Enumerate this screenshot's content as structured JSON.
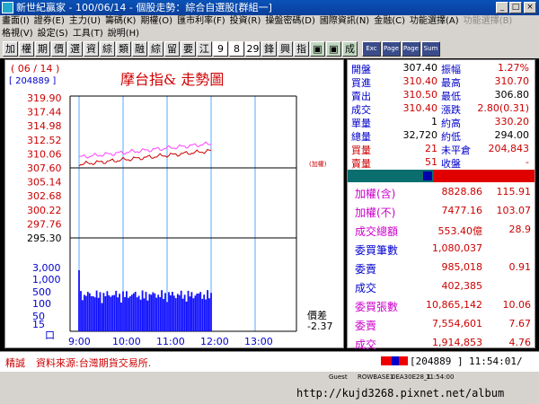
{
  "window": {
    "title": "新世紀贏家 - 100/06/14 - 個股走勢：綜合自選股[群組一]"
  },
  "menu_row1": [
    {
      "label": "畫面(I)"
    },
    {
      "label": "證券(E)"
    },
    {
      "label": "主力(U)"
    },
    {
      "label": "籌碼(K)"
    },
    {
      "label": "期權(O)"
    },
    {
      "label": "匯市利率(F)"
    },
    {
      "label": "投資(R)"
    },
    {
      "label": "操盤密碼(D)"
    },
    {
      "label": "國際資訊(N)"
    },
    {
      "label": "金融(C)"
    },
    {
      "label": "功能選擇(A)"
    },
    {
      "label": "功能選擇(B)",
      "disabled": true
    }
  ],
  "menu_row2": [
    {
      "label": "格視(V)"
    },
    {
      "label": "設定(S)"
    },
    {
      "label": "工具(T)"
    },
    {
      "label": "說明(H)"
    }
  ],
  "toolbar": {
    "buttons": [
      "加",
      "權",
      "期",
      "價",
      "選",
      "資",
      "綜",
      "類",
      "融",
      "綜",
      "留",
      "要",
      "江",
      "9",
      "8",
      "29",
      "鋒",
      "興",
      "指",
      "▣",
      "▣",
      "成"
    ],
    "icon_buttons": [
      "Exc",
      "Page",
      "Page",
      "Sum"
    ]
  },
  "chart": {
    "date": "( 06 / 14 )",
    "code": "[ 204889 ]",
    "title": "摩台指&  走勢圖",
    "price_ticks": [
      "319.90",
      "317.44",
      "314.98",
      "312.52",
      "310.06",
      "307.60",
      "305.14",
      "302.68",
      "300.22",
      "297.76",
      "295.30"
    ],
    "ref_label": "(加權)",
    "volume_ticks": [
      "3,000",
      "1,000",
      "500",
      "100",
      "50",
      "15",
      "口"
    ],
    "time_ticks": [
      "9:00",
      "10:00",
      "11:00",
      "12:00",
      "13:00"
    ],
    "spread_label": "價差",
    "spread_value": "-2.37"
  },
  "quote": {
    "rows": [
      {
        "l1": "開盤",
        "v1": "307.40",
        "l2": "振幅",
        "v2": "1.27%"
      },
      {
        "l1": "買進",
        "v1": "310.40",
        "l2": "最高",
        "v2": "310.70"
      },
      {
        "l1": "賣出",
        "v1": "310.50",
        "l2": "最低",
        "v2": "306.80"
      },
      {
        "l1": "成交",
        "v1": "310.40",
        "l2": "漲跌",
        "v2": "2.80(0.31)"
      },
      {
        "l1": "單量",
        "v1": "1",
        "l2": "約高",
        "v2": "330.20"
      },
      {
        "l1": "總量",
        "v1": "32,720",
        "l2": "約低",
        "v2": "294.00"
      },
      {
        "l1": "買量",
        "v1": "21",
        "l2": "未平倉",
        "v2": "204,843"
      },
      {
        "l1": "賣量",
        "v1": "51",
        "l2": "收盤",
        "v2": "-"
      }
    ]
  },
  "index": {
    "rows": [
      {
        "label": "加權(含)",
        "v1": "8828.86",
        "v2": "115.91"
      },
      {
        "label": "加權(不)",
        "v1": "7477.16",
        "v2": "103.07"
      },
      {
        "label": "成交總額",
        "v1": "553.40億",
        "v2": "28.9"
      },
      {
        "label": "委買筆數",
        "v1": "1,080,037",
        "v2": ""
      },
      {
        "label": "委賣",
        "v1": "985,018",
        "v2": "0.91"
      },
      {
        "label": "成交",
        "v1": "402,385",
        "v2": ""
      },
      {
        "label": "委買張數",
        "v1": "10,865,142",
        "v2": "10.06"
      },
      {
        "label": "委賣",
        "v1": "7,554,601",
        "v2": "7.67"
      },
      {
        "label": "成交",
        "v1": "1,914,853",
        "v2": "4.76"
      }
    ]
  },
  "status": {
    "left": "精誠",
    "source": "資料來源:台灣期貨交易所.",
    "code": "[204889 ]",
    "time": "11:54:01/"
  },
  "taskbar": {
    "items": [
      "Guest",
      "ROWBASE1",
      "0EA30E28_1",
      "11:54:00"
    ]
  },
  "url_text": "http://kujd3268.pixnet.net/album",
  "colors": {
    "price_line": "#cc0000",
    "index_line": "#ff44ff",
    "grid": "#55aaff",
    "volume": "#1111ff",
    "label_blue": "#0000cc",
    "label_magenta": "#cc00cc",
    "value_red": "#cc0000"
  }
}
